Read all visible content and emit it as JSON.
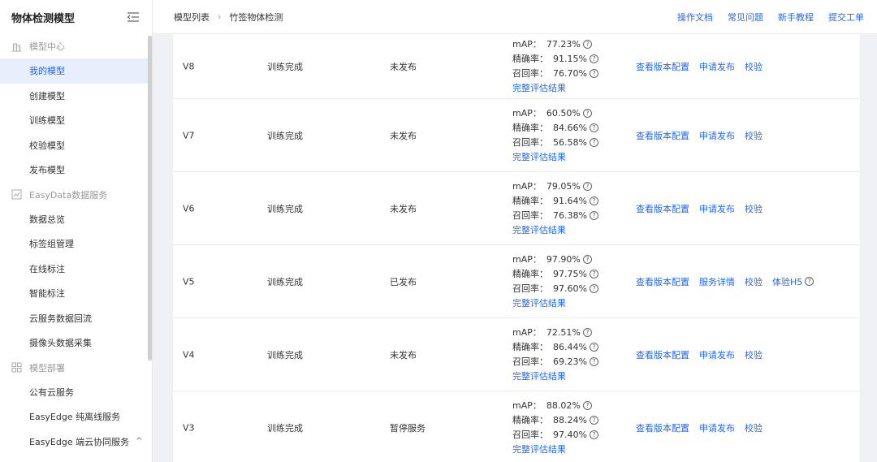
{
  "sidebar": {
    "title": "物体检测模型",
    "groups": [
      {
        "label": "模型中心",
        "icon": "building-icon",
        "items": [
          {
            "label": "我的模型",
            "active": true
          },
          {
            "label": "创建模型"
          },
          {
            "label": "训练模型"
          },
          {
            "label": "校验模型"
          },
          {
            "label": "发布模型"
          }
        ]
      },
      {
        "label": "EasyData数据服务",
        "icon": "data-chart-icon",
        "items": [
          {
            "label": "数据总览"
          },
          {
            "label": "标签组管理"
          },
          {
            "label": "在线标注"
          },
          {
            "label": "智能标注"
          },
          {
            "label": "云服务数据回流"
          },
          {
            "label": "摄像头数据采集"
          }
        ]
      },
      {
        "label": "模型部署",
        "icon": "deploy-grid-icon",
        "items": [
          {
            "label": "公有云服务"
          },
          {
            "label": "EasyEdge 纯离线服务"
          },
          {
            "label": "EasyEdge 端云协同服务",
            "chevron": "^"
          }
        ]
      }
    ]
  },
  "header": {
    "breadcrumb": [
      "模型列表",
      "竹签物体检测"
    ],
    "links": [
      "操作文档",
      "常见问题",
      "新手教程",
      "提交工单"
    ]
  },
  "metric_labels": {
    "map": "mAP：",
    "precision": "精确率：",
    "recall": "召回率：",
    "full": "完整评估结果"
  },
  "rows": [
    {
      "version": "V8",
      "status": "训练完成",
      "publish": "未发布",
      "map": "77.23%",
      "precision": "91.15%",
      "recall": "76.70%",
      "actions": [
        "查看版本配置",
        "申请发布",
        "校验"
      ]
    },
    {
      "version": "V7",
      "status": "训练完成",
      "publish": "未发布",
      "map": "60.50%",
      "precision": "84.66%",
      "recall": "56.58%",
      "actions": [
        "查看版本配置",
        "申请发布",
        "校验"
      ]
    },
    {
      "version": "V6",
      "status": "训练完成",
      "publish": "未发布",
      "map": "79.05%",
      "precision": "91.64%",
      "recall": "76.38%",
      "actions": [
        "查看版本配置",
        "申请发布",
        "校验"
      ]
    },
    {
      "version": "V5",
      "status": "训练完成",
      "publish": "已发布",
      "map": "97.90%",
      "precision": "97.75%",
      "recall": "97.60%",
      "actions": [
        "查看版本配置",
        "服务详情",
        "校验",
        "体验H5"
      ]
    },
    {
      "version": "V4",
      "status": "训练完成",
      "publish": "未发布",
      "map": "72.51%",
      "precision": "86.44%",
      "recall": "69.23%",
      "actions": [
        "查看版本配置",
        "申请发布",
        "校验"
      ]
    },
    {
      "version": "V3",
      "status": "训练完成",
      "publish": "暂停服务",
      "map": "88.02%",
      "precision": "88.24%",
      "recall": "97.40%",
      "actions": [
        "查看版本配置",
        "申请发布",
        "校验"
      ]
    }
  ]
}
